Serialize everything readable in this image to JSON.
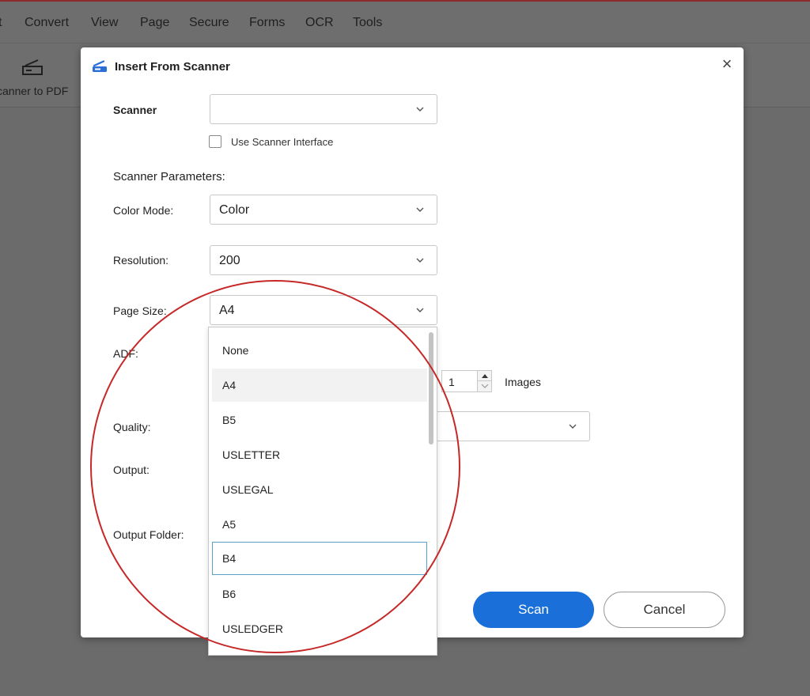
{
  "app": {
    "menu": [
      "t",
      "Convert",
      "View",
      "Page",
      "Secure",
      "Forms",
      "OCR",
      "Tools"
    ],
    "toolbar_label": "canner to PDF"
  },
  "dialog": {
    "title": "Insert From Scanner",
    "close_label": "×",
    "scanner_label": "Scanner",
    "scanner_value": "",
    "use_interface_label": "Use Scanner Interface",
    "params_title": "Scanner Parameters:",
    "color_mode_label": "Color Mode:",
    "color_mode_value": "Color",
    "resolution_label": "Resolution:",
    "resolution_value": "200",
    "page_size_label": "Page Size:",
    "page_size_value": "A4",
    "adf_label": "ADF:",
    "images_value": "1",
    "images_label": "Images",
    "quality_label": "Quality:",
    "output_label": "Output:",
    "output_folder_label": "Output Folder:",
    "scan_button": "Scan",
    "cancel_button": "Cancel"
  },
  "dropdown": {
    "items": [
      "None",
      "A4",
      "B5",
      "USLETTER",
      "USLEGAL",
      "A5",
      "B4",
      "B6",
      "USLEDGER"
    ],
    "selected": "A4",
    "focused": "B4"
  },
  "colors": {
    "accent": "#1a6fd9",
    "annotation": "#c62828",
    "overlay": "#6b6b6b"
  }
}
